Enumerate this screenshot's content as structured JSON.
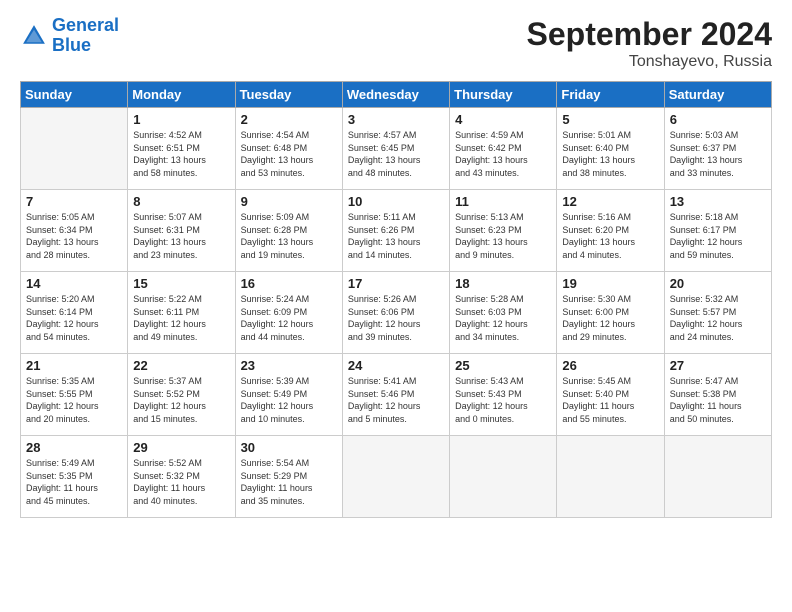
{
  "header": {
    "logo_line1": "General",
    "logo_line2": "Blue",
    "title": "September 2024",
    "subtitle": "Tonshayevo, Russia"
  },
  "weekdays": [
    "Sunday",
    "Monday",
    "Tuesday",
    "Wednesday",
    "Thursday",
    "Friday",
    "Saturday"
  ],
  "days": [
    {
      "num": "",
      "detail": ""
    },
    {
      "num": "1",
      "detail": "Sunrise: 4:52 AM\nSunset: 6:51 PM\nDaylight: 13 hours\nand 58 minutes."
    },
    {
      "num": "2",
      "detail": "Sunrise: 4:54 AM\nSunset: 6:48 PM\nDaylight: 13 hours\nand 53 minutes."
    },
    {
      "num": "3",
      "detail": "Sunrise: 4:57 AM\nSunset: 6:45 PM\nDaylight: 13 hours\nand 48 minutes."
    },
    {
      "num": "4",
      "detail": "Sunrise: 4:59 AM\nSunset: 6:42 PM\nDaylight: 13 hours\nand 43 minutes."
    },
    {
      "num": "5",
      "detail": "Sunrise: 5:01 AM\nSunset: 6:40 PM\nDaylight: 13 hours\nand 38 minutes."
    },
    {
      "num": "6",
      "detail": "Sunrise: 5:03 AM\nSunset: 6:37 PM\nDaylight: 13 hours\nand 33 minutes."
    },
    {
      "num": "7",
      "detail": "Sunrise: 5:05 AM\nSunset: 6:34 PM\nDaylight: 13 hours\nand 28 minutes."
    },
    {
      "num": "8",
      "detail": "Sunrise: 5:07 AM\nSunset: 6:31 PM\nDaylight: 13 hours\nand 23 minutes."
    },
    {
      "num": "9",
      "detail": "Sunrise: 5:09 AM\nSunset: 6:28 PM\nDaylight: 13 hours\nand 19 minutes."
    },
    {
      "num": "10",
      "detail": "Sunrise: 5:11 AM\nSunset: 6:26 PM\nDaylight: 13 hours\nand 14 minutes."
    },
    {
      "num": "11",
      "detail": "Sunrise: 5:13 AM\nSunset: 6:23 PM\nDaylight: 13 hours\nand 9 minutes."
    },
    {
      "num": "12",
      "detail": "Sunrise: 5:16 AM\nSunset: 6:20 PM\nDaylight: 13 hours\nand 4 minutes."
    },
    {
      "num": "13",
      "detail": "Sunrise: 5:18 AM\nSunset: 6:17 PM\nDaylight: 12 hours\nand 59 minutes."
    },
    {
      "num": "14",
      "detail": "Sunrise: 5:20 AM\nSunset: 6:14 PM\nDaylight: 12 hours\nand 54 minutes."
    },
    {
      "num": "15",
      "detail": "Sunrise: 5:22 AM\nSunset: 6:11 PM\nDaylight: 12 hours\nand 49 minutes."
    },
    {
      "num": "16",
      "detail": "Sunrise: 5:24 AM\nSunset: 6:09 PM\nDaylight: 12 hours\nand 44 minutes."
    },
    {
      "num": "17",
      "detail": "Sunrise: 5:26 AM\nSunset: 6:06 PM\nDaylight: 12 hours\nand 39 minutes."
    },
    {
      "num": "18",
      "detail": "Sunrise: 5:28 AM\nSunset: 6:03 PM\nDaylight: 12 hours\nand 34 minutes."
    },
    {
      "num": "19",
      "detail": "Sunrise: 5:30 AM\nSunset: 6:00 PM\nDaylight: 12 hours\nand 29 minutes."
    },
    {
      "num": "20",
      "detail": "Sunrise: 5:32 AM\nSunset: 5:57 PM\nDaylight: 12 hours\nand 24 minutes."
    },
    {
      "num": "21",
      "detail": "Sunrise: 5:35 AM\nSunset: 5:55 PM\nDaylight: 12 hours\nand 20 minutes."
    },
    {
      "num": "22",
      "detail": "Sunrise: 5:37 AM\nSunset: 5:52 PM\nDaylight: 12 hours\nand 15 minutes."
    },
    {
      "num": "23",
      "detail": "Sunrise: 5:39 AM\nSunset: 5:49 PM\nDaylight: 12 hours\nand 10 minutes."
    },
    {
      "num": "24",
      "detail": "Sunrise: 5:41 AM\nSunset: 5:46 PM\nDaylight: 12 hours\nand 5 minutes."
    },
    {
      "num": "25",
      "detail": "Sunrise: 5:43 AM\nSunset: 5:43 PM\nDaylight: 12 hours\nand 0 minutes."
    },
    {
      "num": "26",
      "detail": "Sunrise: 5:45 AM\nSunset: 5:40 PM\nDaylight: 11 hours\nand 55 minutes."
    },
    {
      "num": "27",
      "detail": "Sunrise: 5:47 AM\nSunset: 5:38 PM\nDaylight: 11 hours\nand 50 minutes."
    },
    {
      "num": "28",
      "detail": "Sunrise: 5:49 AM\nSunset: 5:35 PM\nDaylight: 11 hours\nand 45 minutes."
    },
    {
      "num": "29",
      "detail": "Sunrise: 5:52 AM\nSunset: 5:32 PM\nDaylight: 11 hours\nand 40 minutes."
    },
    {
      "num": "30",
      "detail": "Sunrise: 5:54 AM\nSunset: 5:29 PM\nDaylight: 11 hours\nand 35 minutes."
    },
    {
      "num": "",
      "detail": ""
    },
    {
      "num": "",
      "detail": ""
    },
    {
      "num": "",
      "detail": ""
    },
    {
      "num": "",
      "detail": ""
    }
  ]
}
